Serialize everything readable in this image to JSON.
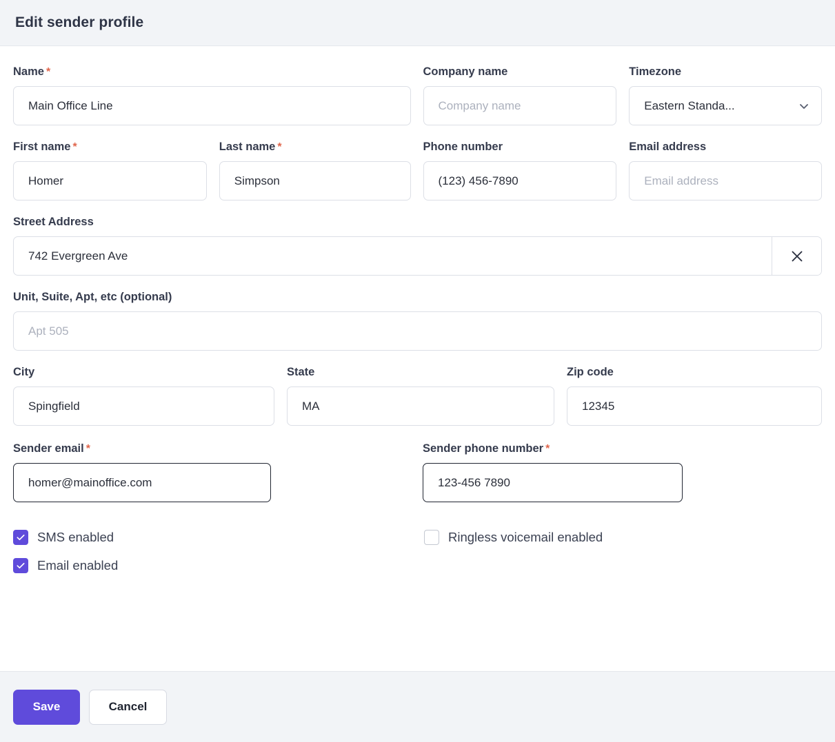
{
  "header": {
    "title": "Edit sender profile"
  },
  "form": {
    "name": {
      "label": "Name",
      "required": true,
      "value": "Main Office Line",
      "placeholder": "Name"
    },
    "company_name": {
      "label": "Company name",
      "required": false,
      "value": "",
      "placeholder": "Company name"
    },
    "timezone": {
      "label": "Timezone",
      "required": false,
      "value": "Eastern Standa...",
      "icon": "chevron-down-icon"
    },
    "first_name": {
      "label": "First name",
      "required": true,
      "value": "Homer",
      "placeholder": "First name"
    },
    "last_name": {
      "label": "Last name",
      "required": true,
      "value": "Simpson",
      "placeholder": "Last name"
    },
    "phone_number": {
      "label": "Phone number",
      "required": false,
      "value": "(123) 456-7890",
      "placeholder": "Phone number"
    },
    "email_address": {
      "label": "Email address",
      "required": false,
      "value": "",
      "placeholder": "Email address"
    },
    "street_address": {
      "label": "Street Address",
      "required": false,
      "value": "742 Evergreen Ave",
      "placeholder": "Street Address",
      "clear_icon": "close-icon"
    },
    "unit": {
      "label": "Unit, Suite, Apt, etc (optional)",
      "required": false,
      "value": "",
      "placeholder": "Apt 505"
    },
    "city": {
      "label": "City",
      "required": false,
      "value": "Spingfield",
      "placeholder": "City"
    },
    "state": {
      "label": "State",
      "required": false,
      "value": "MA",
      "placeholder": "State"
    },
    "zip_code": {
      "label": "Zip code",
      "required": false,
      "value": "12345",
      "placeholder": "Zip code"
    },
    "sender_email": {
      "label": "Sender email",
      "required": true,
      "value": "homer@mainoffice.com",
      "placeholder": "Sender email"
    },
    "sender_phone_number": {
      "label": "Sender phone number",
      "required": true,
      "value": "123-456 7890",
      "placeholder": "Sender phone number"
    }
  },
  "checkboxes": {
    "sms_enabled": {
      "label": "SMS enabled",
      "checked": true
    },
    "email_enabled": {
      "label": "Email enabled",
      "checked": true
    },
    "ringless_voicemail_enabled": {
      "label": "Ringless voicemail enabled",
      "checked": false
    }
  },
  "footer": {
    "save_label": "Save",
    "cancel_label": "Cancel"
  },
  "colors": {
    "accent": "#5f4bdb",
    "required_asterisk": "#e0654b",
    "header_bg": "#f2f4f7",
    "border": "#dcdfe6",
    "text": "#2b2f3a",
    "placeholder": "#acb1bd"
  },
  "required_marker": "*"
}
